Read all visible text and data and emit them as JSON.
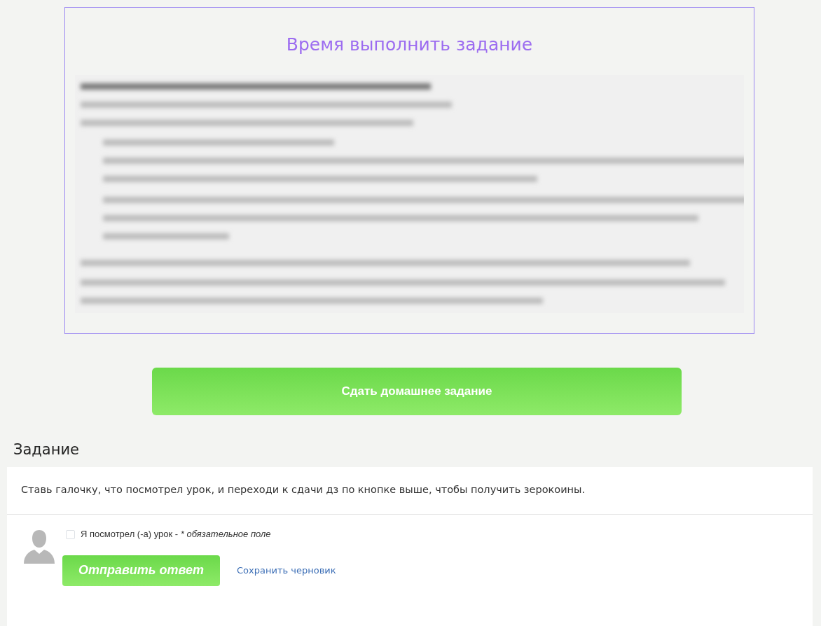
{
  "task_panel": {
    "title": "Время выполнить задание"
  },
  "submit_homework_button": "Сдать домашнее задание",
  "section": {
    "heading": "Задание",
    "instruction": "Ставь галочку, что посмотрел урок, и переходи к сдачи дз по кнопке выше, чтобы получить зерокоины.",
    "checkbox": {
      "label": "Я посмотрел (-а) урок -",
      "required_note": "* обязательное поле",
      "checked": false
    },
    "buttons": [
      {
        "kind": "primary",
        "label": "Отправить ответ"
      },
      {
        "kind": "link",
        "label": "Сохранить черновик"
      }
    ]
  }
}
